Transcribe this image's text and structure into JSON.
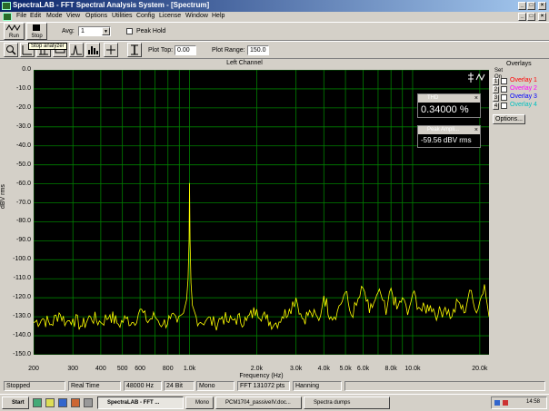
{
  "window": {
    "title": "SpectraLAB - FFT Spectral Analysis System - [Spectrum]",
    "min": "_",
    "max": "□",
    "close": "×",
    "doc_min": "_",
    "doc_max": "□",
    "doc_close": "×"
  },
  "menu": [
    "File",
    "Edit",
    "Mode",
    "View",
    "Options",
    "Utilities",
    "Config",
    "License",
    "Window",
    "Help"
  ],
  "toolbar": {
    "run_label": "Run",
    "stop_label": "Stop",
    "avg_label": "Avg:",
    "avg_value": "1",
    "peak_hold_label": "Peak Hold",
    "tooltip": "Stop analyzer",
    "plot_top_label": "Plot Top:",
    "plot_top_value": "0.00",
    "plot_range_label": "Plot Range:",
    "plot_range_value": "150.0"
  },
  "overlays": {
    "title": "Overlays",
    "set_label": "Set",
    "on_label": "On",
    "items": [
      {
        "num": "1",
        "label": "Overlay 1",
        "color": "#ff0000"
      },
      {
        "num": "2",
        "label": "Overlay 2",
        "color": "#ff00ff"
      },
      {
        "num": "3",
        "label": "Overlay 3",
        "color": "#0000ff"
      },
      {
        "num": "4",
        "label": "Overlay 4",
        "color": "#00c0c0"
      }
    ],
    "options_label": "Options..."
  },
  "thd_panel": {
    "title": "THD",
    "value": "0.34000 %"
  },
  "peak_panel": {
    "title": "Peak Ampli...",
    "value": "-59.56 dBV rms"
  },
  "chart_data": {
    "type": "line",
    "title": "Left Channel",
    "xlabel": "Frequency (Hz)",
    "ylabel": "dBV rms",
    "x_scale": "log",
    "xlim": [
      200,
      22000
    ],
    "ylim": [
      -150,
      0
    ],
    "y_ticks": [
      "0.0",
      "-10.0",
      "-20.0",
      "-30.0",
      "-40.0",
      "-50.0",
      "-60.0",
      "-70.0",
      "-80.0",
      "-90.0",
      "-100.0",
      "-110.0",
      "-120.0",
      "-130.0",
      "-140.0",
      "-150.0"
    ],
    "x_ticks": [
      {
        "v": 200,
        "label": "200"
      },
      {
        "v": 300,
        "label": "300"
      },
      {
        "v": 400,
        "label": "400"
      },
      {
        "v": 500,
        "label": "500"
      },
      {
        "v": 600,
        "label": "600"
      },
      {
        "v": 800,
        "label": "800"
      },
      {
        "v": 1000,
        "label": "1.0k"
      },
      {
        "v": 2000,
        "label": "2.0k"
      },
      {
        "v": 3000,
        "label": "3.0k"
      },
      {
        "v": 4000,
        "label": "4.0k"
      },
      {
        "v": 5000,
        "label": "5.0k"
      },
      {
        "v": 6000,
        "label": "6.0k"
      },
      {
        "v": 8000,
        "label": "8.0k"
      },
      {
        "v": 10000,
        "label": "10.0k"
      },
      {
        "v": 20000,
        "label": "20.0k"
      }
    ],
    "grid": true,
    "line_color": "#ffff00",
    "grid_color": "#008000",
    "series": [
      {
        "points": [
          [
            200,
            -133
          ],
          [
            220,
            -131
          ],
          [
            240,
            -134
          ],
          [
            260,
            -128
          ],
          [
            280,
            -133
          ],
          [
            300,
            -131
          ],
          [
            330,
            -135
          ],
          [
            360,
            -130
          ],
          [
            400,
            -133
          ],
          [
            440,
            -129
          ],
          [
            480,
            -134
          ],
          [
            520,
            -131
          ],
          [
            560,
            -133
          ],
          [
            600,
            -126
          ],
          [
            640,
            -132
          ],
          [
            700,
            -130
          ],
          [
            760,
            -134
          ],
          [
            820,
            -131
          ],
          [
            880,
            -133
          ],
          [
            940,
            -128
          ],
          [
            970,
            -121
          ],
          [
            985,
            -110
          ],
          [
            995,
            -90
          ],
          [
            1000,
            -59.6
          ],
          [
            1005,
            -90
          ],
          [
            1015,
            -112
          ],
          [
            1030,
            -124
          ],
          [
            1070,
            -130
          ],
          [
            1120,
            -133
          ],
          [
            1200,
            -131
          ],
          [
            1300,
            -134
          ],
          [
            1400,
            -130
          ],
          [
            1500,
            -133
          ],
          [
            1600,
            -131
          ],
          [
            1800,
            -132
          ],
          [
            2000,
            -126
          ],
          [
            2200,
            -131
          ],
          [
            2400,
            -134
          ],
          [
            2600,
            -130
          ],
          [
            2800,
            -126
          ],
          [
            3000,
            -120
          ],
          [
            3200,
            -131
          ],
          [
            3500,
            -128
          ],
          [
            3800,
            -132
          ],
          [
            4000,
            -119
          ],
          [
            4300,
            -130
          ],
          [
            4600,
            -127
          ],
          [
            5000,
            -117
          ],
          [
            5300,
            -129
          ],
          [
            5600,
            -124
          ],
          [
            6000,
            -115
          ],
          [
            6400,
            -128
          ],
          [
            6800,
            -121
          ],
          [
            7200,
            -118
          ],
          [
            7600,
            -129
          ],
          [
            8000,
            -115
          ],
          [
            8500,
            -126
          ],
          [
            9000,
            -120
          ],
          [
            9500,
            -129
          ],
          [
            10000,
            -118
          ],
          [
            11000,
            -127
          ],
          [
            12000,
            -124
          ],
          [
            13000,
            -129
          ],
          [
            14000,
            -125
          ],
          [
            15000,
            -130
          ],
          [
            16000,
            -122
          ],
          [
            17000,
            -128
          ],
          [
            18000,
            -116
          ],
          [
            19000,
            -126
          ],
          [
            20000,
            -122
          ],
          [
            21000,
            -113
          ],
          [
            22000,
            -130
          ]
        ]
      }
    ]
  },
  "status": {
    "state": "Stopped",
    "mode": "Real Time",
    "rate": "48000 Hz",
    "bits": "24 Bit",
    "channels": "Mono",
    "fft": "FFT 131072 pts",
    "window": "Hanning"
  },
  "taskbar": {
    "start": "Start",
    "tasks": [
      "SpectraLAB - FFT ...",
      "Mono",
      "PCM1704_passiveIV.doc...",
      "Spectra dumps"
    ],
    "clock": "14:58"
  }
}
